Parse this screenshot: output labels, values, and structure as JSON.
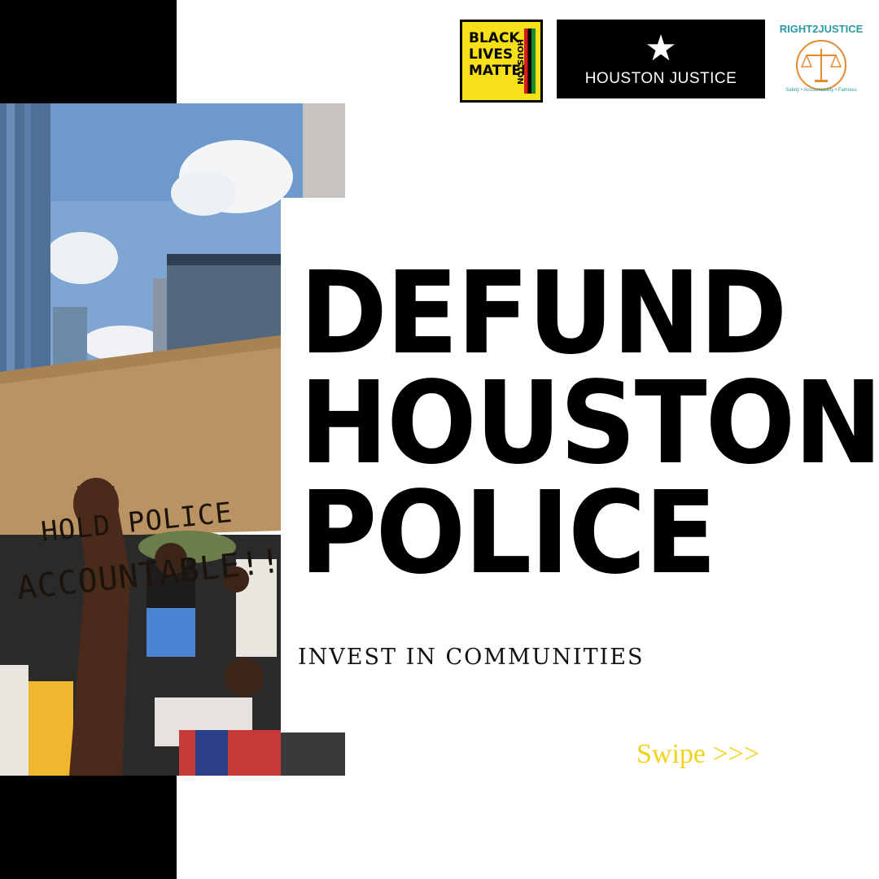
{
  "headline": {
    "line1": "DEFUND",
    "line2": "HOUSTON",
    "line3": "POLICE"
  },
  "subhead": "INVEST IN COMMUNITIES",
  "swipe_label": "Swipe >>>",
  "photo": {
    "sign_line1": "HOLD POLICE",
    "sign_line2": "ACCOUNTABLE!!!"
  },
  "logos": {
    "blm": {
      "words": [
        "BLACK",
        "LIVES",
        "MATTER"
      ],
      "city": "HOUSTON"
    },
    "houston_justice": {
      "icon": "star-icon",
      "name": "HOUSTON JUSTICE"
    },
    "right2justice": {
      "name": "RIGHT2JUSTICE",
      "tagline": "Safety • Accountability • Fairness",
      "icon": "scales-icon"
    }
  },
  "colors": {
    "black": "#000000",
    "swipe_yellow": "#f2d21a",
    "blm_yellow": "#f7e01a",
    "r2j_teal": "#2a9aa0",
    "r2j_orange": "#e58a2e"
  }
}
